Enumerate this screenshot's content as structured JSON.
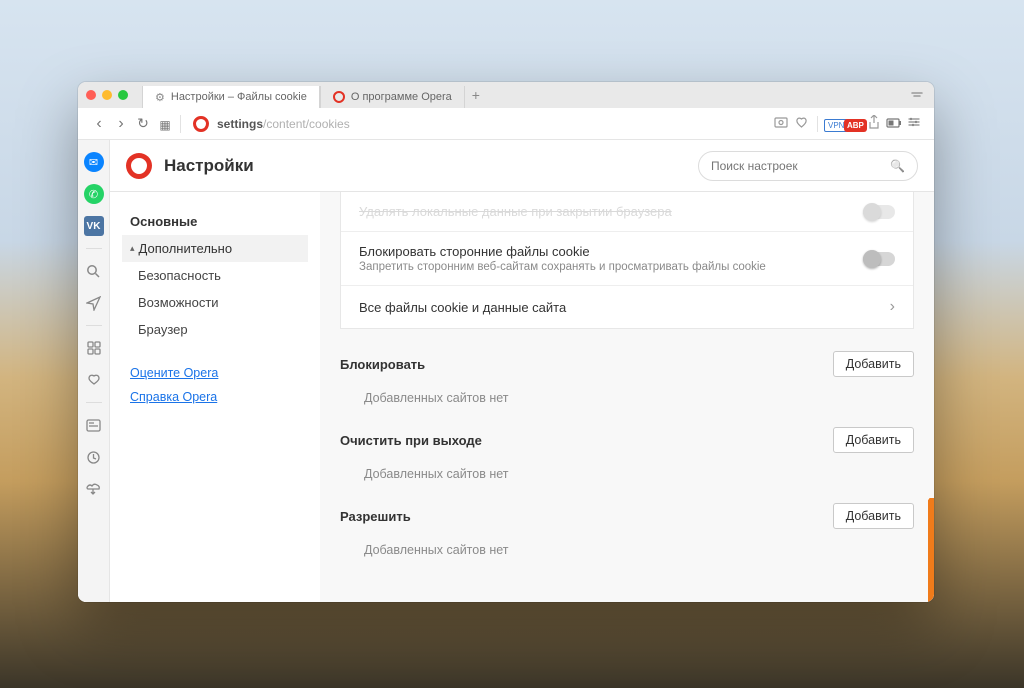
{
  "tabs": {
    "active": "Настройки – Файлы cookie",
    "inactive": "О программе Opera"
  },
  "url": {
    "bold": "settings",
    "rest": "/content/cookies"
  },
  "header": {
    "title": "Настройки",
    "search_placeholder": "Поиск настроек"
  },
  "sidebar": {
    "basic": "Основные",
    "advanced": "Дополнительно",
    "security": "Безопасность",
    "features": "Возможности",
    "browser": "Браузер",
    "rate": "Оцените Opera",
    "help": "Справка Opera"
  },
  "cookies": {
    "delete_on_close": "Удалять локальные данные при закрытии браузера",
    "block_third_party": "Блокировать сторонние файлы cookie",
    "block_third_party_desc": "Запретить сторонним веб-сайтам сохранять и просматривать файлы cookie",
    "all_cookies": "Все файлы cookie и данные сайта",
    "block_section": "Блокировать",
    "clear_on_exit_section": "Очистить при выходе",
    "allow_section": "Разрешить",
    "empty": "Добавленных сайтов нет",
    "add": "Добавить"
  }
}
